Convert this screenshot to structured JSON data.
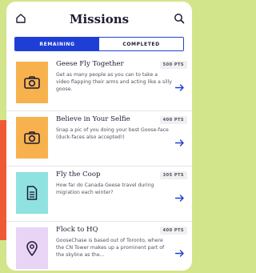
{
  "header": {
    "title": "Missions"
  },
  "tabs": [
    {
      "label": "REMAINING"
    },
    {
      "label": "COMPLETED"
    }
  ],
  "missions": [
    {
      "name": "Geese Fly Together",
      "points": "500 PTS",
      "description": "Get as many people as you can to take a video flapping their arms and acting like a silly goose.",
      "icon": "camera-icon",
      "color": "#f7b24e"
    },
    {
      "name": "Believe in Your Selfie",
      "points": "400 PTS",
      "description": "Snap a pic of you doing your best Goose-face (duck-faces also accepted!)",
      "icon": "camera-icon",
      "color": "#f7b24e"
    },
    {
      "name": "Fly the Coop",
      "points": "305 PTS",
      "description": "How far do Canada Geese travel during migration each winter?",
      "icon": "document-icon",
      "color": "#8fe2e0"
    },
    {
      "name": "Flock to HQ",
      "points": "400 PTS",
      "description": "GooseChase is based out of Toronto, where the CN Tower makes up a prominent part of the skyline as the...",
      "icon": "location-pin-icon",
      "color": "#e9d4f5"
    }
  ],
  "colors": {
    "accent": "#1e3fd6",
    "background": "#d3e58b",
    "blob": "#ef5a34"
  }
}
